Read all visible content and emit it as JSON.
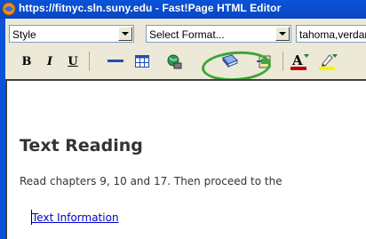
{
  "window": {
    "title": "https://fitnyc.sln.suny.edu - Fast!Page HTML Editor"
  },
  "toolbar": {
    "style_select": "Style",
    "format_select": "Select Format...",
    "font_select": "tahoma,verdana",
    "bold_label": "B",
    "italic_label": "I",
    "underline_label": "U"
  },
  "editor": {
    "heading": "Text Reading",
    "paragraph": "Read chapters 9, 10 and 17. Then proceed to the",
    "link_text": "Text Information"
  },
  "colors": {
    "titlebar": "#0a52d8",
    "highlight_circle": "#3aa635",
    "link": "#0000cc"
  }
}
